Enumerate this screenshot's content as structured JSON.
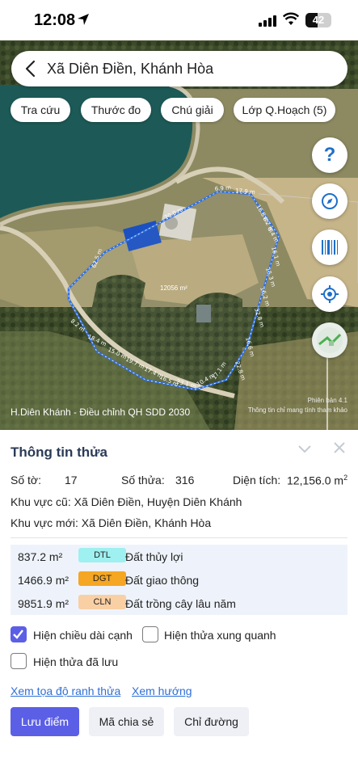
{
  "status_bar": {
    "time": "12:08",
    "battery": "42"
  },
  "search": {
    "title": "Xã Diên Điền, Khánh Hòa"
  },
  "chips": [
    "Tra cứu",
    "Thước đo",
    "Chú giải",
    "Lớp Q.Hoạch (5)"
  ],
  "map": {
    "footer_left": "H.Diên Khánh - Điều chỉnh QH SDD 2030",
    "footer_right_line1": "Phiên bản 4.1",
    "footer_right_line2": "Thông tin chỉ mang tính tham khảo",
    "area_label": "12056 m²",
    "edge_labels": [
      "70.0 m",
      "6.9 m",
      "17.9 m",
      "16.8 m",
      "6.2 m",
      "8.4 m",
      "16.1 m",
      "15.3 m",
      "16.2 m",
      "32.8 m",
      "16.6 m",
      "22.8 m",
      "17.1 m",
      "10.4 m",
      "23.1 m",
      "16.5 m",
      "17.4 m",
      "19.7 m",
      "15.0 m",
      "18.4 m",
      "8.2 m",
      "62.5 m"
    ]
  },
  "info": {
    "title": "Thông tin thửa",
    "so_to_label": "Số tờ:",
    "so_to_value": "17",
    "so_thua_label": "Số thửa:",
    "so_thua_value": "316",
    "dien_tich_label": "Diện tích:",
    "dien_tich_value": "12,156.0 m",
    "dien_tich_unit_sup": "2",
    "old_area_label": "Khu vực cũ:",
    "old_area_value": "Xã Diên Điền, Huyện Diên Khánh",
    "new_area_label": "Khu vực mới:",
    "new_area_value": "Xã Diên Điền, Khánh Hòa"
  },
  "land_uses": [
    {
      "area": "837.2 m²",
      "code": "DTL",
      "name": "Đất thủy lợi",
      "color": "#9ff0f0"
    },
    {
      "area": "1466.9 m²",
      "code": "DGT",
      "name": "Đất giao thông",
      "color": "#f5a623"
    },
    {
      "area": "9851.9 m²",
      "code": "CLN",
      "name": "Đất trồng cây lâu năm",
      "color": "#f9cfa4"
    }
  ],
  "options": {
    "show_edge_length": "Hiện chiều dài cạnh",
    "show_neighbors": "Hiện thửa xung quanh",
    "show_saved": "Hiện thửa đã lưu"
  },
  "links": {
    "coords": "Xem tọa độ ranh thửa",
    "direction": "Xem hướng"
  },
  "buttons": {
    "save_point": "Lưu điểm",
    "share_code": "Mã chia sẻ",
    "directions": "Chỉ đường"
  },
  "colors": {
    "accent": "#5b5fe6",
    "parcel_outline": "#2f6fe0",
    "link": "#2f6fd6"
  }
}
